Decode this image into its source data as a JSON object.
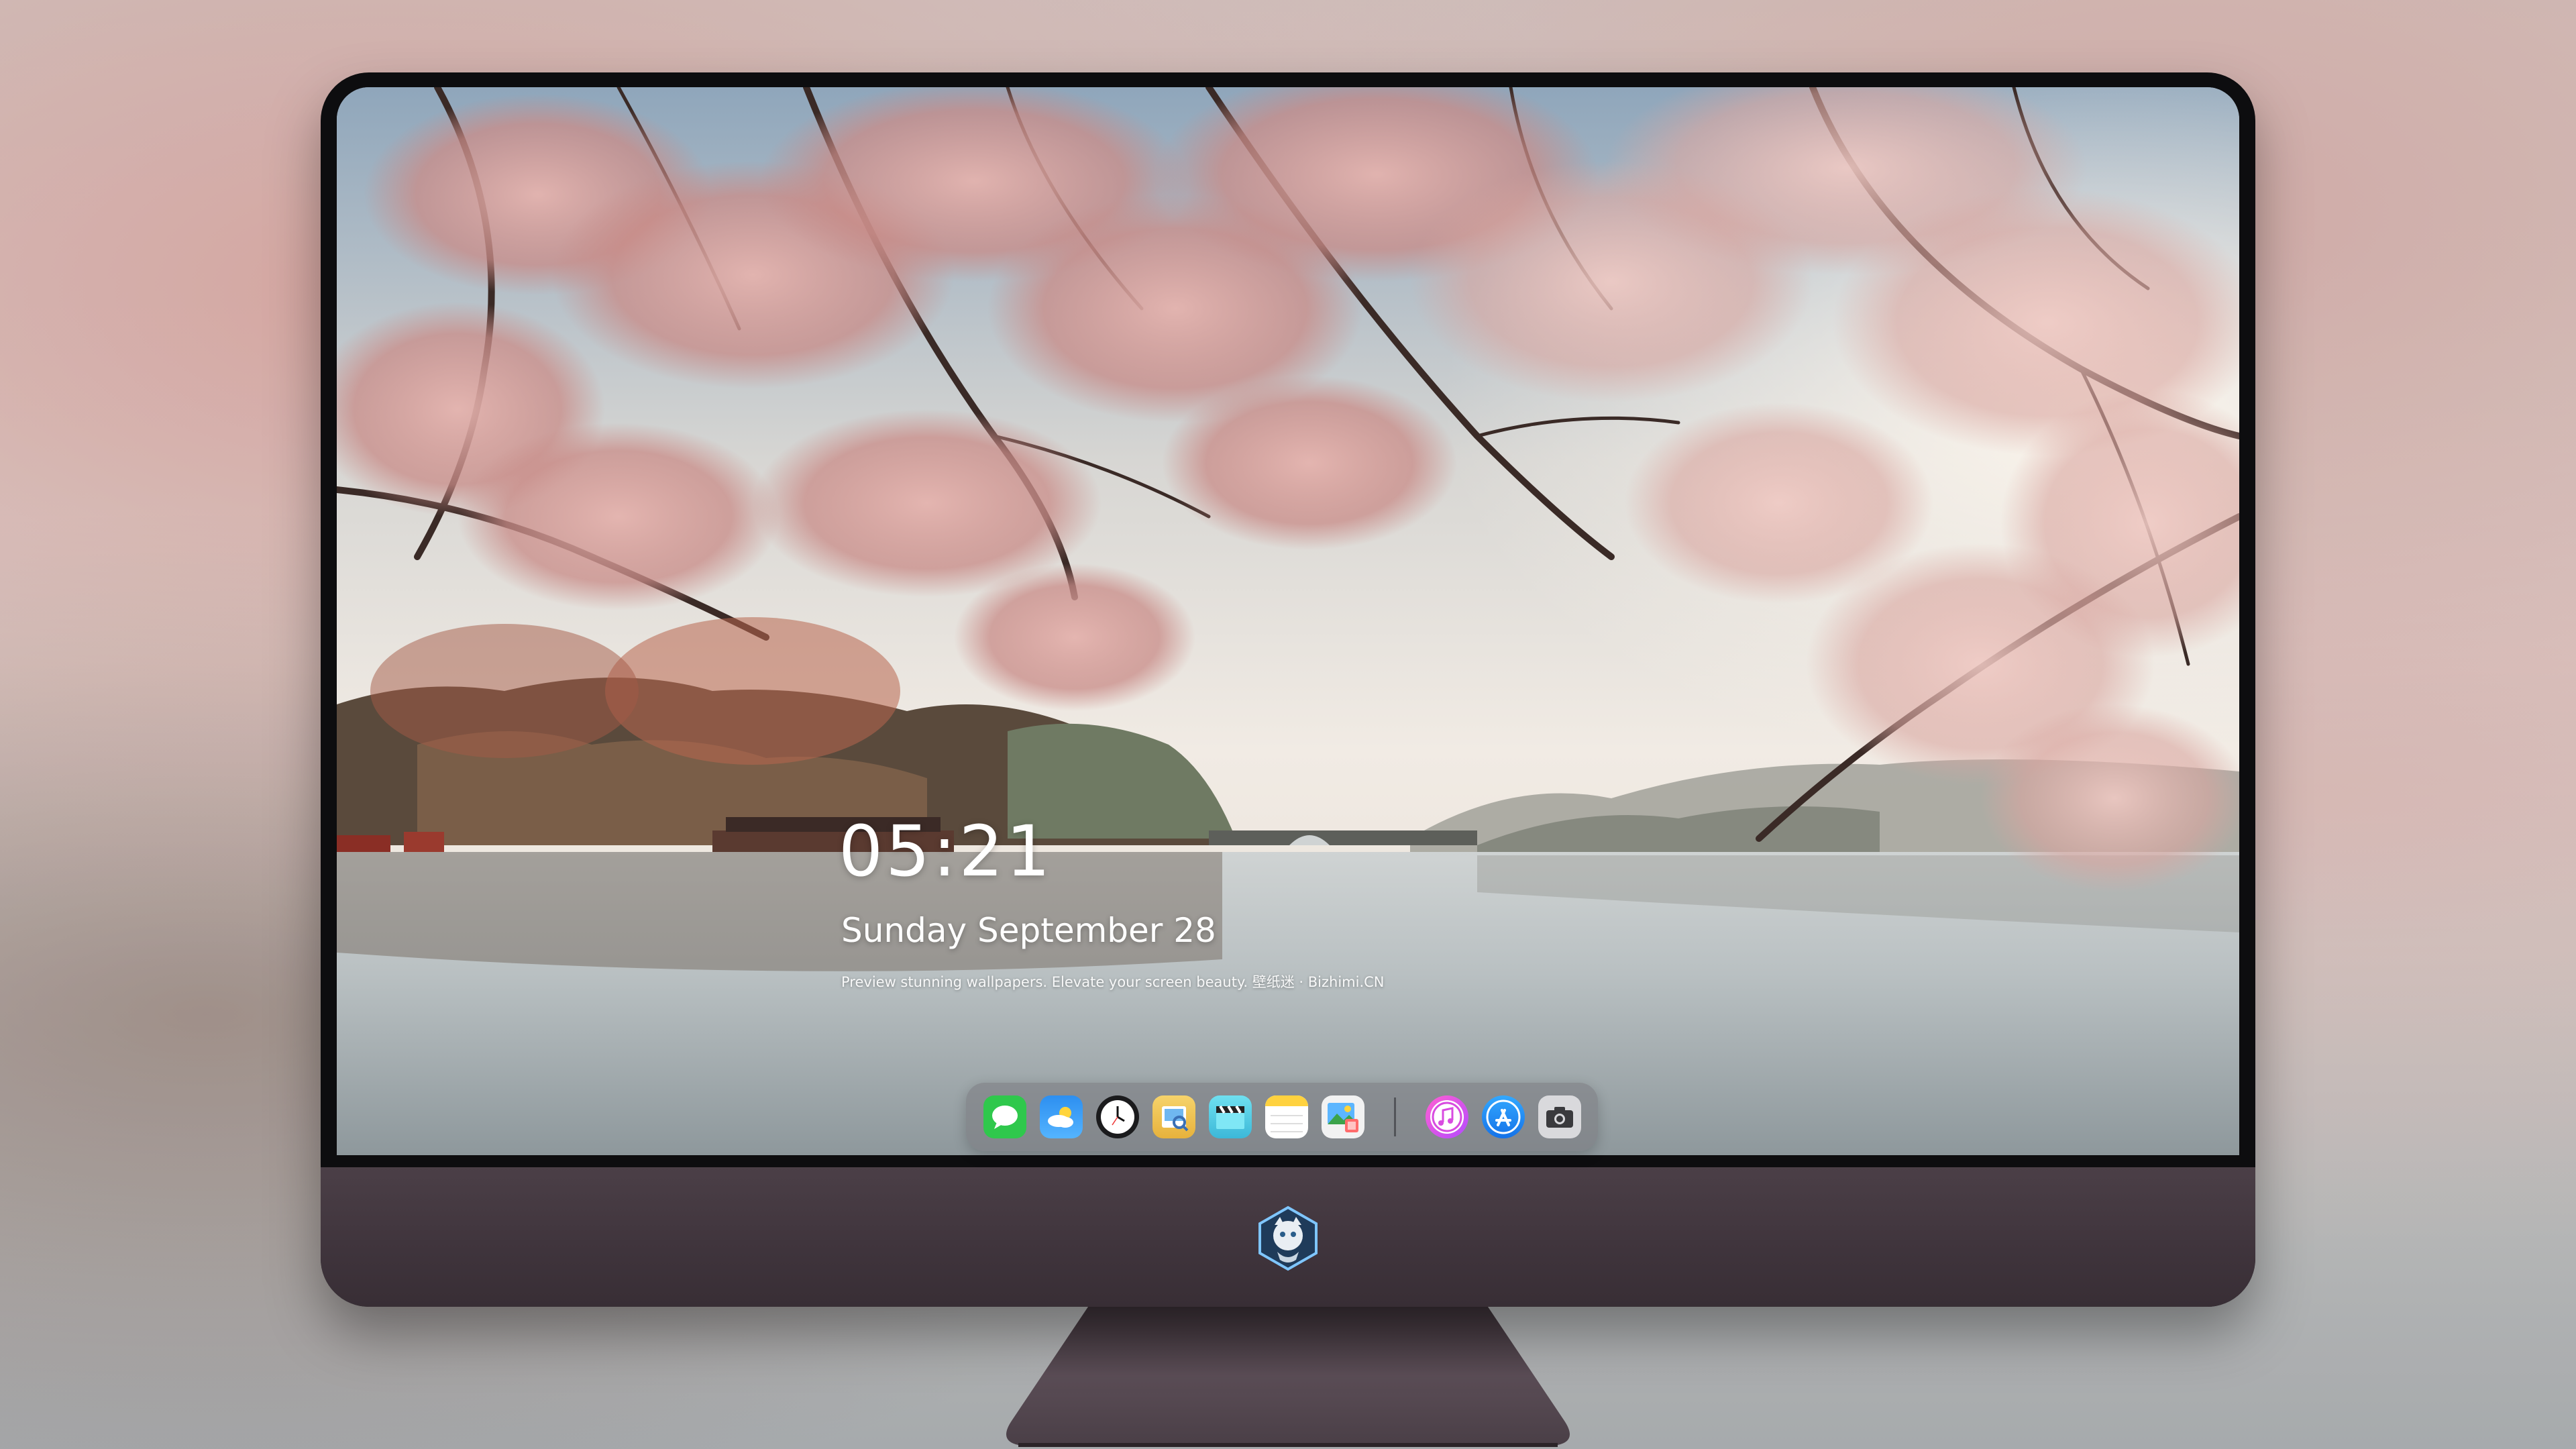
{
  "lockscreen": {
    "time": "05:21",
    "date": "Sunday September  28",
    "tagline": "Preview stunning wallpapers. Elevate your screen beauty. 壁纸迷 · Bizhimi.CN"
  },
  "dock": {
    "apps": [
      {
        "name": "messages-icon"
      },
      {
        "name": "weather-icon"
      },
      {
        "name": "clock-icon"
      },
      {
        "name": "preview-icon"
      },
      {
        "name": "video-clapper-icon"
      },
      {
        "name": "notes-icon"
      },
      {
        "name": "photo-editor-icon"
      },
      {
        "name": "music-icon"
      },
      {
        "name": "app-store-icon"
      },
      {
        "name": "camera-icon"
      }
    ]
  },
  "colors": {
    "chin": "#3f343c",
    "bezel": "#0d0d0f",
    "blossom": "#d79c99"
  }
}
